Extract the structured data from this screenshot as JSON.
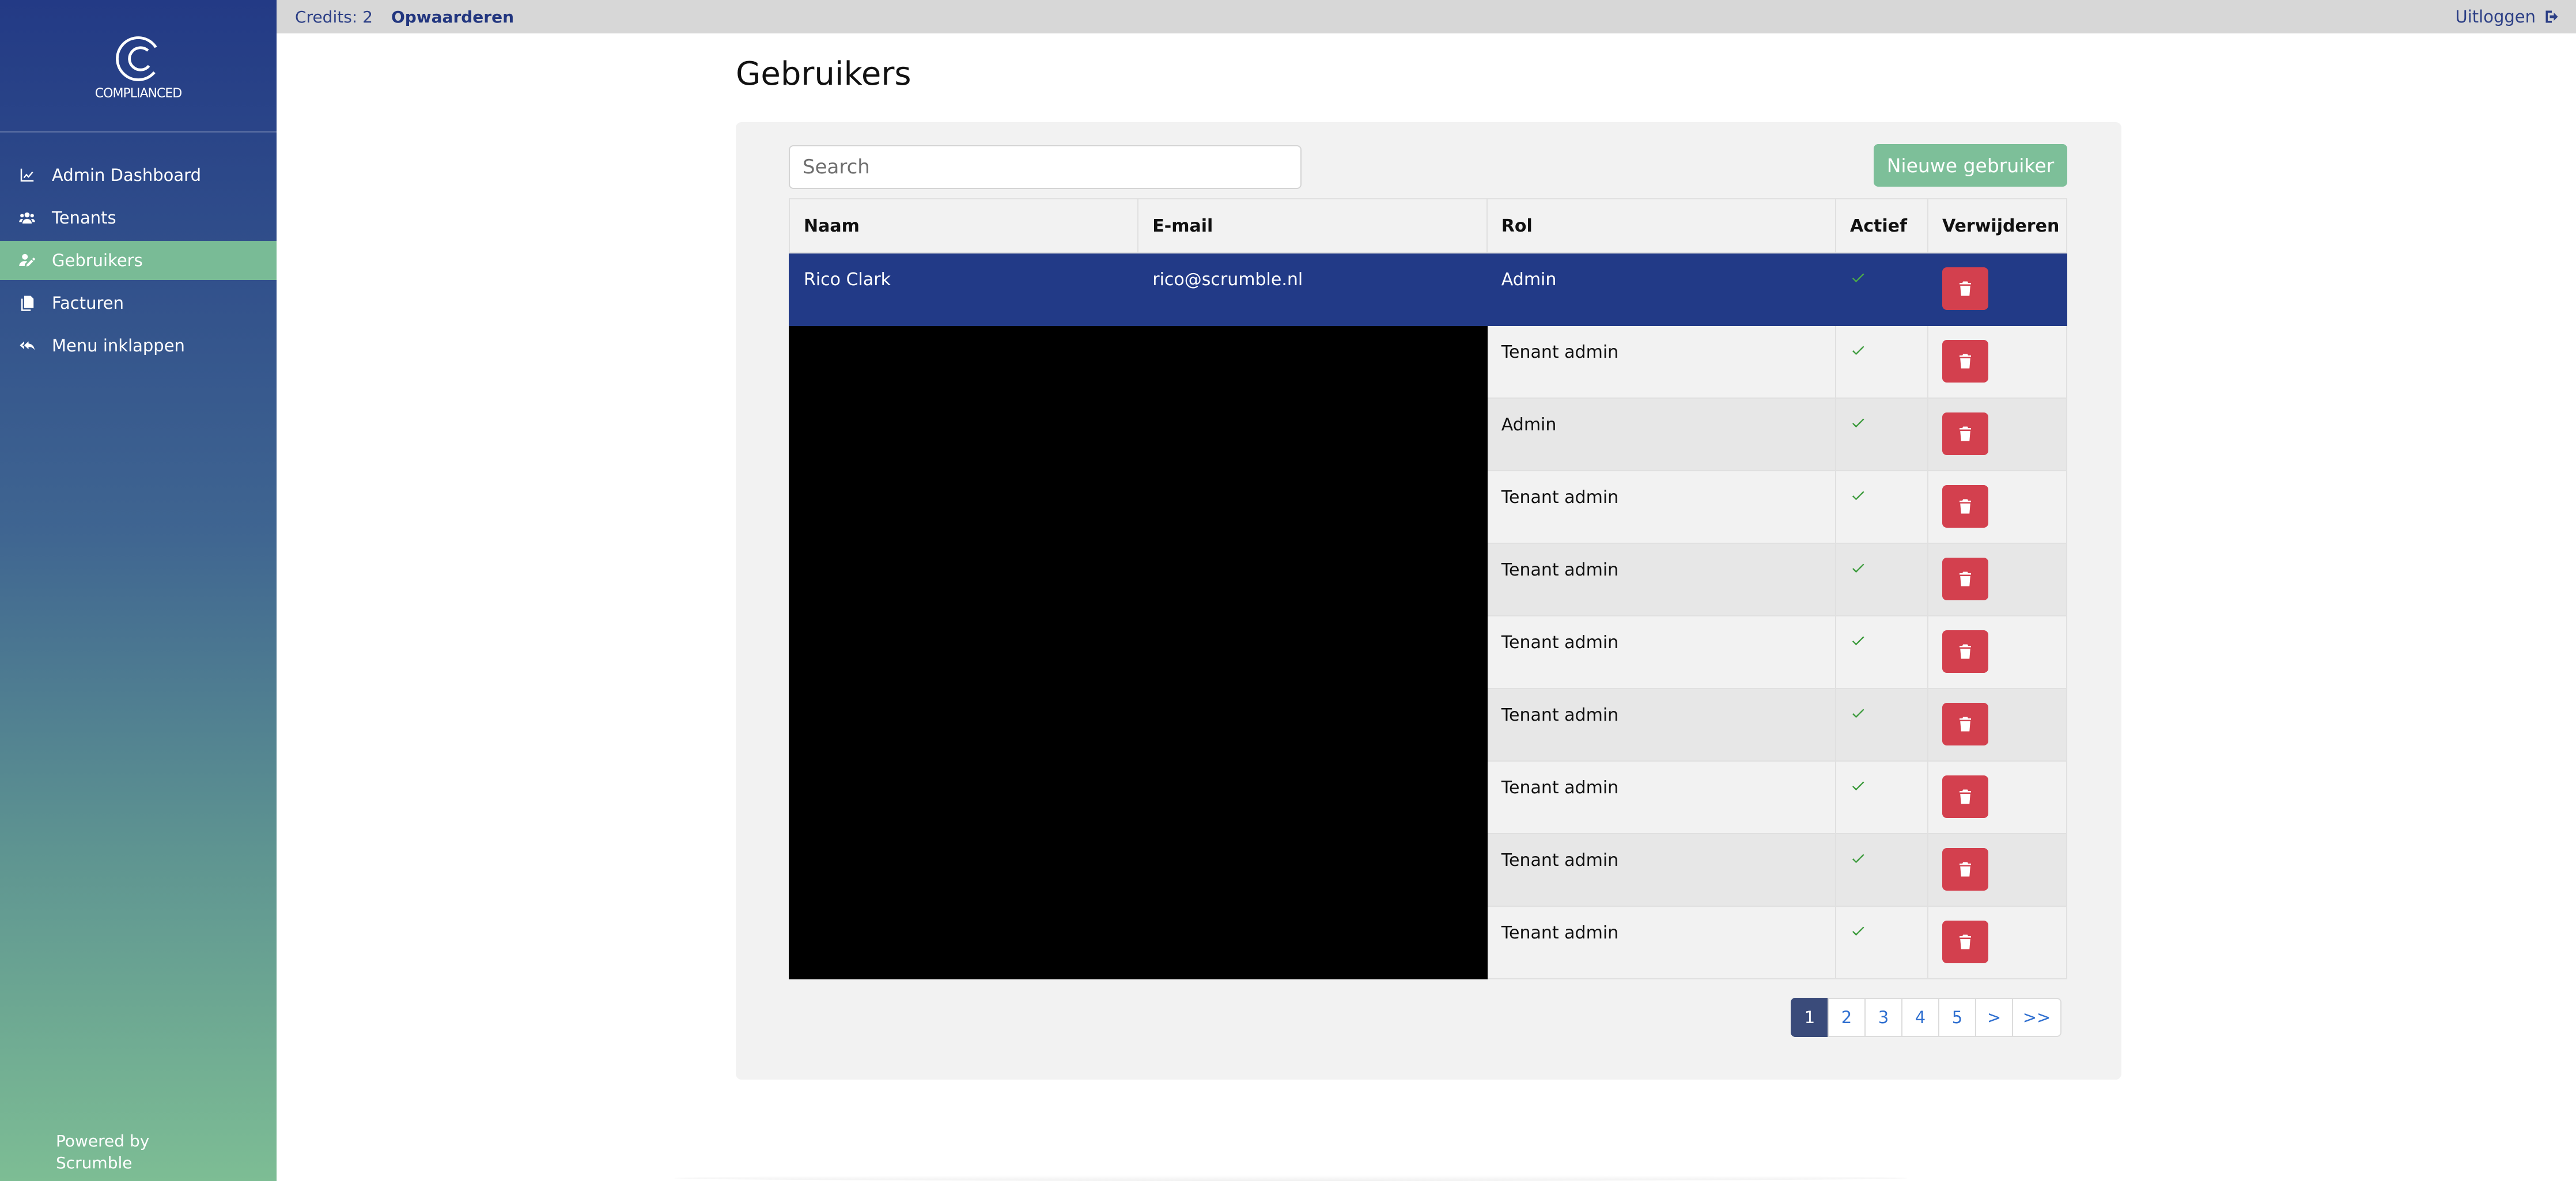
{
  "app": {
    "logo_text": "COMPLIANCED",
    "powered_line1": "Powered by",
    "powered_line2": "Scrumble"
  },
  "sidebar": {
    "items": [
      {
        "label": "Admin Dashboard",
        "icon": "chart-line-icon",
        "active": false
      },
      {
        "label": "Tenants",
        "icon": "users-icon",
        "active": false
      },
      {
        "label": "Gebruikers",
        "icon": "user-edit-icon",
        "active": true
      },
      {
        "label": "Facturen",
        "icon": "copy-icon",
        "active": false
      },
      {
        "label": "Menu inklappen",
        "icon": "reply-all-icon",
        "active": false
      }
    ]
  },
  "topbar": {
    "credits": "Credits: 2",
    "topup": "Opwaarderen",
    "logout": "Uitloggen"
  },
  "main": {
    "title": "Gebruikers",
    "search_placeholder": "Search",
    "new_user_label": "Nieuwe gebruiker",
    "columns": [
      "Naam",
      "E-mail",
      "Rol",
      "Actief",
      "Verwijderen"
    ],
    "rows": [
      {
        "name": "Rico Clark",
        "email": "rico@scrumble.nl",
        "role": "Admin",
        "active": true,
        "selected": true
      },
      {
        "name": "",
        "email": "",
        "role": "Tenant admin",
        "active": true,
        "redacted": true
      },
      {
        "name": "",
        "email": "",
        "role": "Admin",
        "active": true,
        "redacted": true
      },
      {
        "name": "",
        "email": "",
        "role": "Tenant admin",
        "active": true,
        "redacted": true
      },
      {
        "name": "",
        "email": "",
        "role": "Tenant admin",
        "active": true,
        "redacted": true
      },
      {
        "name": "",
        "email": "",
        "role": "Tenant admin",
        "active": true,
        "redacted": true
      },
      {
        "name": "",
        "email": "",
        "role": "Tenant admin",
        "active": true,
        "redacted": true
      },
      {
        "name": "",
        "email": "",
        "role": "Tenant admin",
        "active": true,
        "redacted": true
      },
      {
        "name": "",
        "email": "",
        "role": "Tenant admin",
        "active": true,
        "redacted": true
      },
      {
        "name": "",
        "email": "",
        "role": "Tenant admin",
        "active": true,
        "redacted": true
      }
    ],
    "pagination": [
      "1",
      "2",
      "3",
      "4",
      "5",
      ">",
      ">>"
    ],
    "current_page": "1"
  },
  "colors": {
    "primary": "#223a87",
    "accent_green": "#7dbf99",
    "danger": "#d3404e",
    "check": "#3a9a3a"
  }
}
